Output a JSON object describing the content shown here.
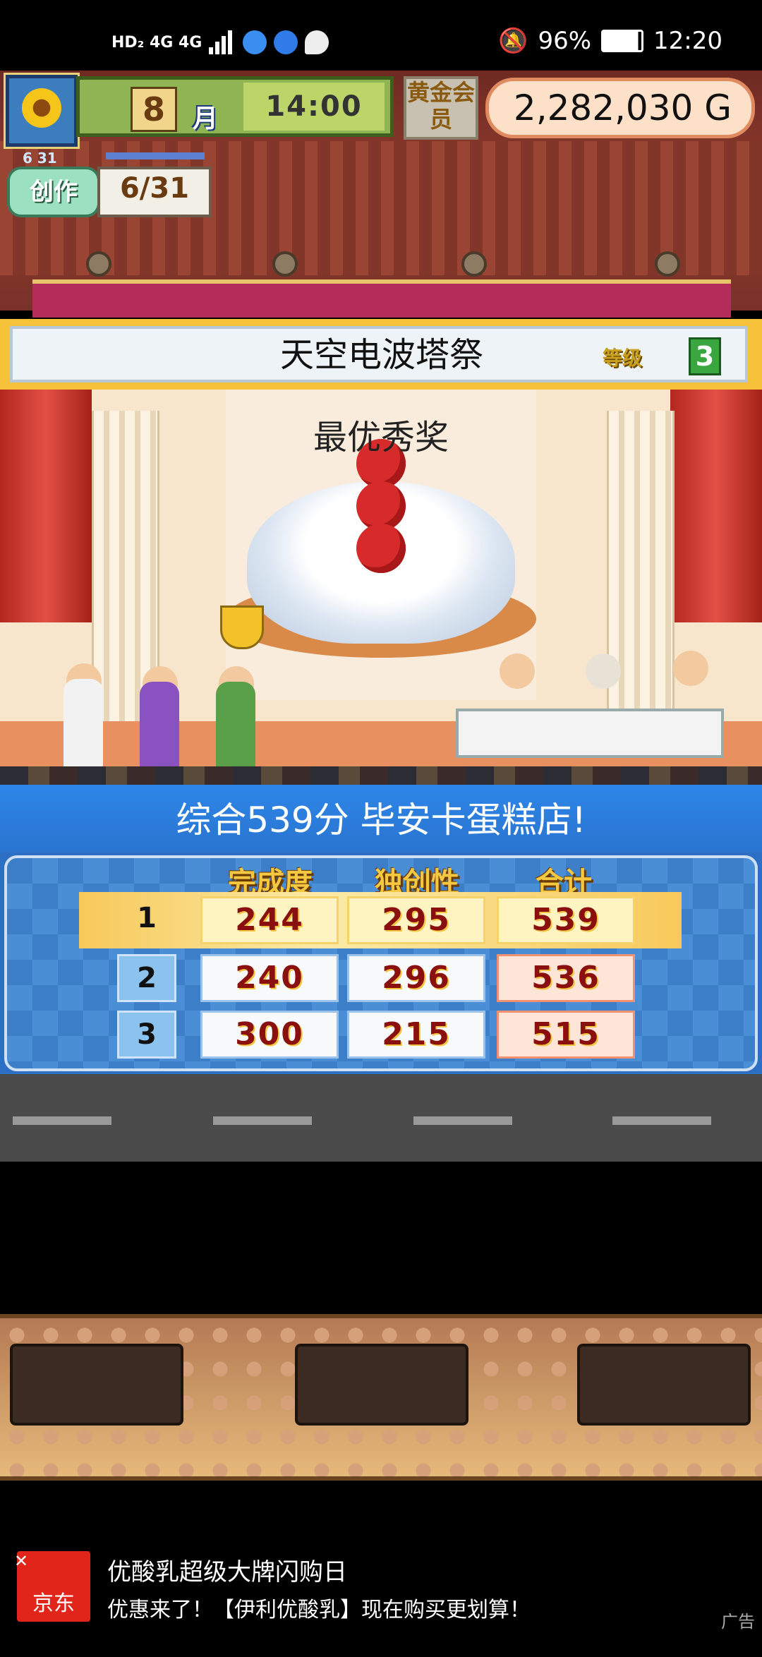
{
  "status_bar": {
    "left_text": "HD₂  4G  4G",
    "battery": "96%",
    "time": "12:20"
  },
  "header": {
    "month_number": "8",
    "month_label": "月",
    "time": "14:00",
    "gold_member_label": "黄金会员",
    "gold_amount": "2,282,030 G",
    "create_date": "6 31",
    "create_label": "创作",
    "create_value": "6/31"
  },
  "event": {
    "title": "天空电波塔祭",
    "level_label": "等级",
    "level_value": "3",
    "award": "最优秀奖"
  },
  "results": {
    "summary": "综合539分 毕安卡蛋糕店!",
    "columns": [
      "完成度",
      "独创性",
      "合计"
    ],
    "rows": [
      {
        "rank": "1",
        "completion": "244",
        "originality": "295",
        "total": "539"
      },
      {
        "rank": "2",
        "completion": "240",
        "originality": "296",
        "total": "536"
      },
      {
        "rank": "3",
        "completion": "300",
        "originality": "215",
        "total": "515"
      }
    ]
  },
  "ad": {
    "logo_text": "京东",
    "title": "优酸乳超级大牌闪购日",
    "description": "优惠来了！【伊利优酸乳】现在购买更划算！",
    "tag": "广告"
  },
  "colors": {
    "banner_gold": "#f5c23a",
    "result_blue": "#2d6fc4",
    "score_red": "#8a1010",
    "ad_red": "#e1251b"
  }
}
